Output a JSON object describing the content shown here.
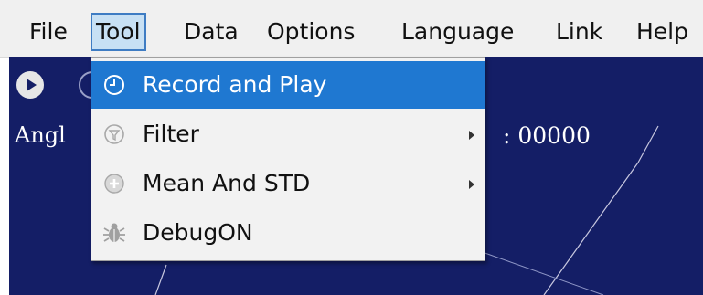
{
  "menubar": {
    "items": [
      "File",
      "Tool",
      "Data",
      "Options",
      "Language",
      "Link",
      "Help"
    ],
    "active": "Tool"
  },
  "canvas": {
    "angle_label": "Angl",
    "count_label": ":  00000"
  },
  "tool_menu": {
    "items": [
      {
        "label": "Record and Play",
        "icon": "clock-icon",
        "has_submenu": false,
        "highlighted": true
      },
      {
        "label": "Filter",
        "icon": "filter-icon",
        "has_submenu": true,
        "highlighted": false
      },
      {
        "label": "Mean And STD",
        "icon": "plus-circle-icon",
        "has_submenu": true,
        "highlighted": false
      },
      {
        "label": "DebugON",
        "icon": "bug-icon",
        "has_submenu": false,
        "highlighted": false
      }
    ]
  },
  "colors": {
    "canvas_bg": "#141e66",
    "menu_highlight": "#1f78d1",
    "menubar_active": "#c7e0f4"
  }
}
